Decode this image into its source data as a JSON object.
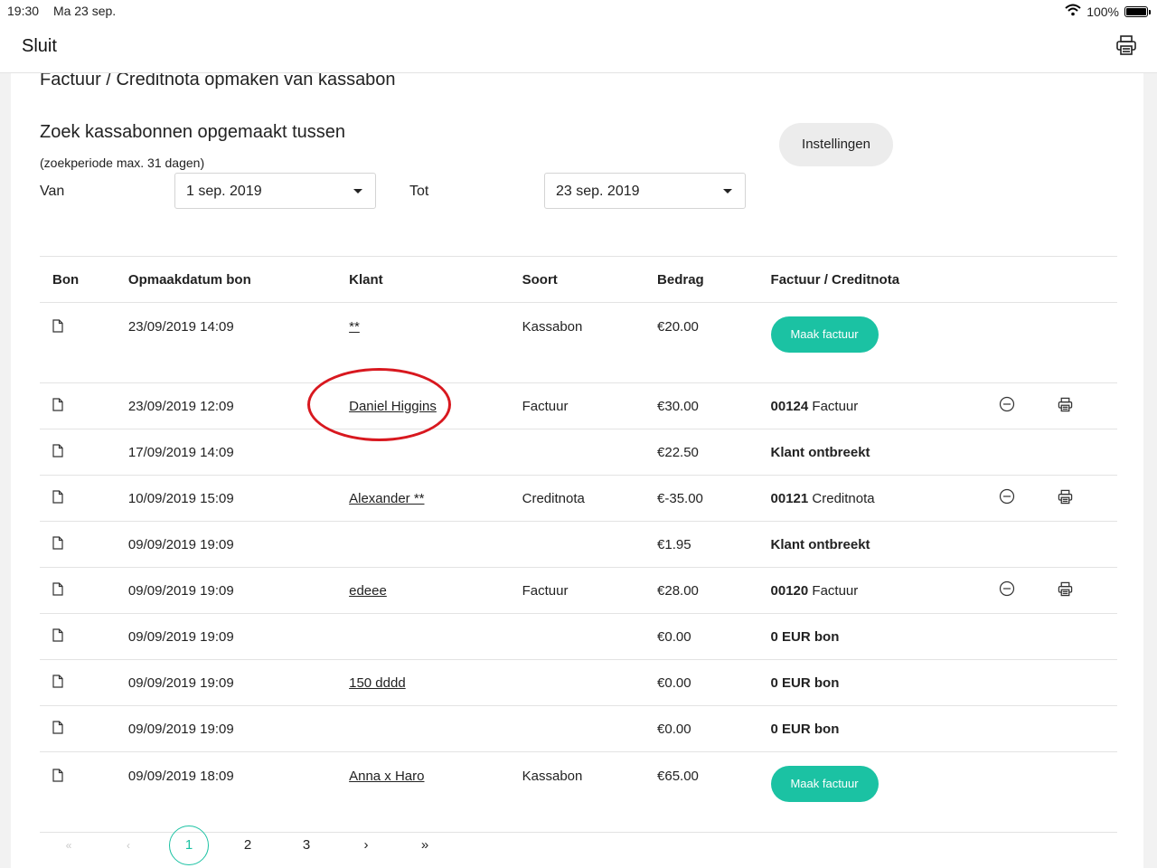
{
  "status": {
    "time": "19:30",
    "date": "Ma 23 sep.",
    "battery": "100%"
  },
  "nav": {
    "close_label": "Sluit"
  },
  "page": {
    "title": "Factuur / Creditnota opmaken van kassabon",
    "search_title": "Zoek kassabonnen opgemaakt tussen",
    "period_note": "(zoekperiode max. 31 dagen)",
    "from_label": "Van",
    "from_value": "1 sep. 2019",
    "to_label": "Tot",
    "to_value": "23 sep. 2019",
    "settings_label": "Instellingen"
  },
  "table": {
    "headers": {
      "bon": "Bon",
      "date": "Opmaakdatum bon",
      "klant": "Klant",
      "soort": "Soort",
      "bedrag": "Bedrag",
      "fact": "Factuur / Creditnota"
    },
    "rows": [
      {
        "date": "23/09/2019 14:09",
        "klant": "**",
        "soort": "Kassabon",
        "bedrag": "€20.00",
        "fact_button": "Maak factuur"
      },
      {
        "date": "23/09/2019 12:09",
        "klant": "Daniel Higgins",
        "soort": "Factuur",
        "bedrag": "€30.00",
        "fact_number": "00124",
        "fact_type": "Factuur"
      },
      {
        "date": "17/09/2019 14:09",
        "klant": "",
        "soort": "",
        "bedrag": "€22.50",
        "fact_text": "Klant ontbreekt"
      },
      {
        "date": "10/09/2019 15:09",
        "klant": "Alexander **",
        "soort": "Creditnota",
        "bedrag": "€-35.00",
        "fact_number": "00121",
        "fact_type": "Creditnota"
      },
      {
        "date": "09/09/2019 19:09",
        "klant": "",
        "soort": "",
        "bedrag": "€1.95",
        "fact_text": "Klant ontbreekt"
      },
      {
        "date": "09/09/2019 19:09",
        "klant": "edeee",
        "soort": "Factuur",
        "bedrag": "€28.00",
        "fact_number": "00120",
        "fact_type": "Factuur"
      },
      {
        "date": "09/09/2019 19:09",
        "klant": "",
        "soort": "",
        "bedrag": "€0.00",
        "fact_text": "0 EUR bon"
      },
      {
        "date": "09/09/2019 19:09",
        "klant": "150 dddd",
        "soort": "",
        "bedrag": "€0.00",
        "fact_text": "0 EUR bon"
      },
      {
        "date": "09/09/2019 19:09",
        "klant": "",
        "soort": "",
        "bedrag": "€0.00",
        "fact_text": "0 EUR bon"
      },
      {
        "date": "09/09/2019 18:09",
        "klant": "Anna x Haro",
        "soort": "Kassabon",
        "bedrag": "€65.00",
        "fact_button": "Maak factuur"
      }
    ]
  },
  "pagination": {
    "first": "«",
    "prev": "‹",
    "pages": [
      "1",
      "2",
      "3"
    ],
    "next": "›",
    "last": "»"
  },
  "colors": {
    "accent": "#1bc2a3",
    "annotation": "#d8181f"
  }
}
